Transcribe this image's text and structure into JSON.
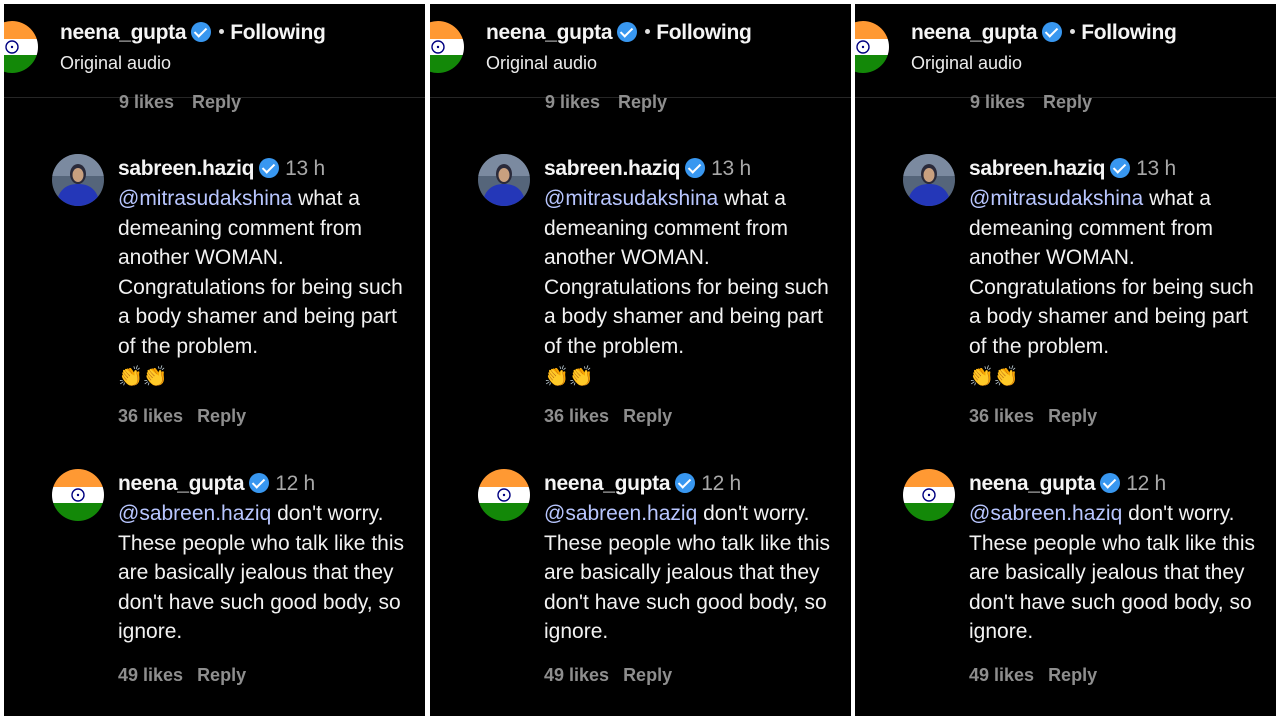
{
  "panels": [
    {
      "header": {
        "username": "neena_gupta",
        "following": "Following",
        "subtitle": "Original audio"
      },
      "partial": {
        "likes": "9 likes",
        "reply": "Reply"
      },
      "comments": [
        {
          "username": "sabreen.haziq",
          "time": "13 h",
          "mention": "@mitrasudakshina",
          "text": " what a demeaning comment from another WOMAN. Congratulations for being such a body shamer and being part of the problem.",
          "emoji": "👏👏",
          "likes": "36 likes",
          "reply": "Reply"
        },
        {
          "username": "neena_gupta",
          "time": "12 h",
          "mention": "@sabreen.haziq",
          "text": " don't worry. These people who talk like this are basically jealous that they don't have such good body, so ignore.",
          "likes": "49 likes",
          "reply": "Reply"
        }
      ]
    },
    {
      "header": {
        "username": "neena_gupta",
        "following": "Following",
        "subtitle": "Original audio"
      },
      "partial": {
        "likes": "9 likes",
        "reply": "Reply"
      },
      "comments": [
        {
          "username": "sabreen.haziq",
          "time": "13 h",
          "mention": "@mitrasudakshina",
          "text": " what a demeaning comment from another WOMAN. Congratulations for being such a body shamer and being part of the problem.",
          "emoji": "👏👏",
          "likes": "36 likes",
          "reply": "Reply"
        },
        {
          "username": "neena_gupta",
          "time": "12 h",
          "mention": "@sabreen.haziq",
          "text": " don't worry. These people who talk like this are basically jealous that they don't have such good body, so ignore.",
          "likes": "49 likes",
          "reply": "Reply"
        }
      ]
    },
    {
      "header": {
        "username": "neena_gupta",
        "following": "Following",
        "subtitle": "Original audio"
      },
      "partial": {
        "likes": "9 likes",
        "reply": "Reply"
      },
      "comments": [
        {
          "username": "sabreen.haziq",
          "time": "13 h",
          "mention": "@mitrasudakshina",
          "text": " what a demeaning comment from another WOMAN. Congratulations for being such a body shamer and being part of the problem.",
          "emoji": "👏👏",
          "likes": "36 likes",
          "reply": "Reply"
        },
        {
          "username": "neena_gupta",
          "time": "12 h",
          "mention": "@sabreen.haziq",
          "text": " don't worry. These people who talk like this are basically jealous that they don't have such good body, so ignore.",
          "likes": "49 likes",
          "reply": "Reply"
        }
      ]
    }
  ],
  "colors": {
    "background": "#000000",
    "verified": "#3897f0",
    "mention": "#b8c6ff",
    "meta": "#8e8e8e"
  },
  "icons": {
    "verified": "verified-badge-icon",
    "flag_avatar": "india-flag-avatar",
    "clap": "clapping-hands-emoji"
  }
}
